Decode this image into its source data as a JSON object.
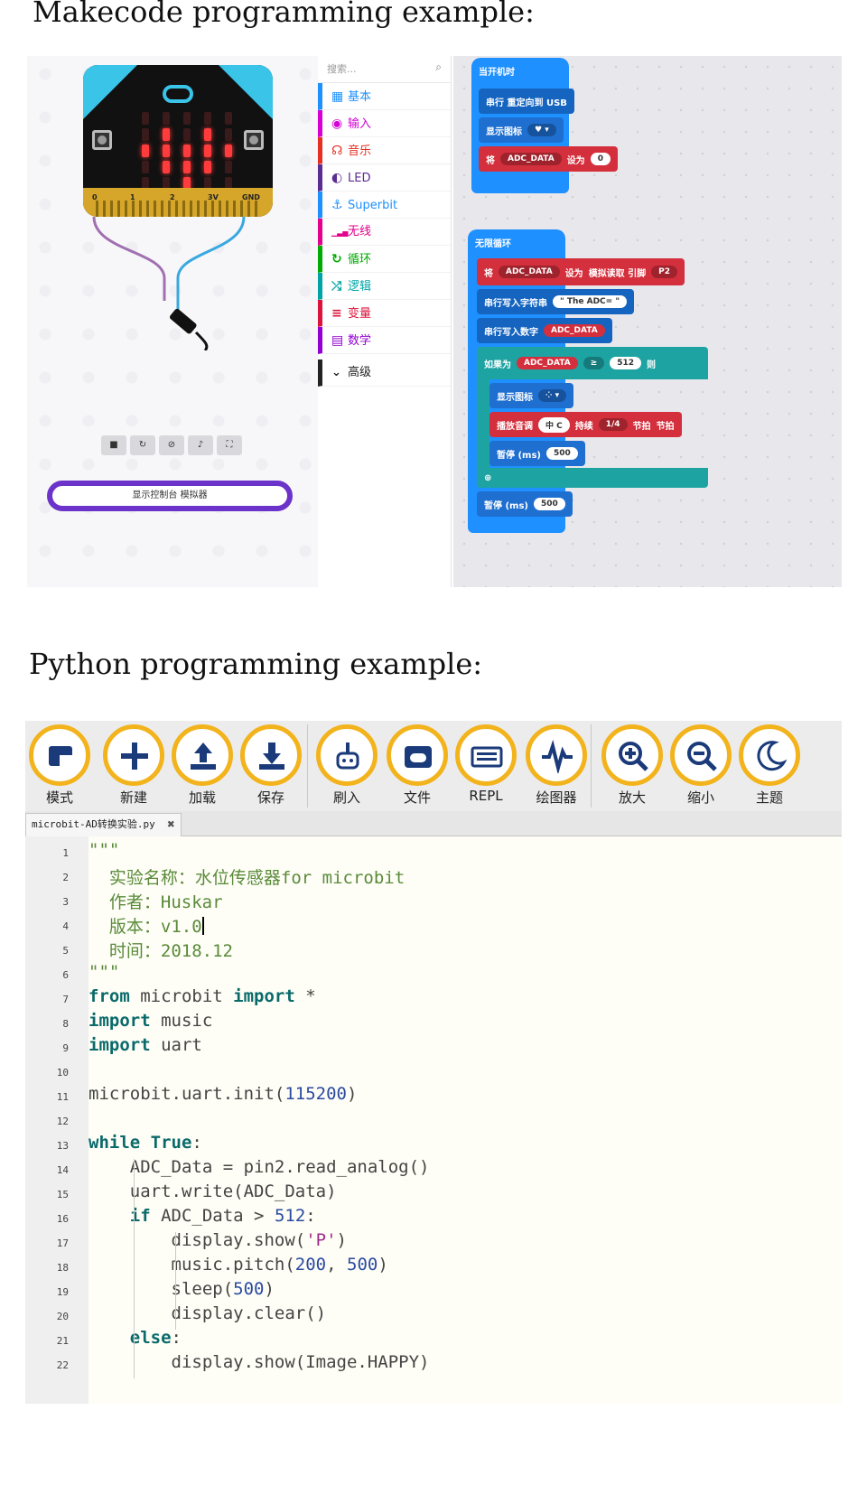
{
  "headings": {
    "makecode": "Makecode programming example:",
    "python": "Python programming example:"
  },
  "makecode": {
    "simulator": {
      "pins": [
        "0",
        "1",
        "2",
        "3V",
        "GND"
      ],
      "led_matrix": [
        0,
        0,
        0,
        0,
        0,
        0,
        1,
        0,
        1,
        0,
        1,
        1,
        1,
        1,
        1,
        0,
        1,
        1,
        1,
        0,
        0,
        0,
        1,
        0,
        0
      ],
      "console_button": "显示控制台 模拟器"
    },
    "toolbox": {
      "search_placeholder": "搜索...",
      "categories": [
        {
          "label": "基本",
          "icon": "grid-icon",
          "color": "#1e90ff"
        },
        {
          "label": "输入",
          "icon": "target-icon",
          "color": "#d400d4"
        },
        {
          "label": "音乐",
          "icon": "headphones-icon",
          "color": "#e63022"
        },
        {
          "label": "LED",
          "icon": "toggle-icon",
          "color": "#5c2d91"
        },
        {
          "label": "Superbit",
          "icon": "anchor-icon",
          "color": "#1e90ff"
        },
        {
          "label": "无线",
          "icon": "signal-icon",
          "color": "#e3008c"
        },
        {
          "label": "循环",
          "icon": "loop-icon",
          "color": "#00aa00"
        },
        {
          "label": "逻辑",
          "icon": "shuffle-icon",
          "color": "#00a4a6"
        },
        {
          "label": "变量",
          "icon": "list-icon",
          "color": "#dc143c"
        },
        {
          "label": "数学",
          "icon": "calculator-icon",
          "color": "#9400d3"
        }
      ],
      "advanced": "高级"
    },
    "blocks": {
      "on_start": "当开机时",
      "serial_redirect": "串行 重定向到 USB",
      "show_icon": "显示图标",
      "set": "将",
      "var": "ADC_DATA",
      "set_to": "设为",
      "zero": "0",
      "forever": "无限循环",
      "analog_read": "模拟读取 引脚",
      "pin": "P2",
      "serial_write_string": "串行写入字符串",
      "string_val": "\" The ADC= \"",
      "serial_write_number": "串行写入数字",
      "if": "如果为",
      "op": "≥",
      "threshold": "512",
      "then": "则",
      "play_tone": "播放音调",
      "tone": "中 C",
      "duration": "持续",
      "beat": "1/4",
      "beat_unit": "节拍",
      "beat_unit2": "节拍",
      "pause": "暂停 (ms)",
      "pause_val": "500"
    }
  },
  "mu": {
    "toolbar": [
      {
        "label": "模式",
        "icon": "mode-icon"
      },
      {
        "label": "新建",
        "icon": "plus-icon"
      },
      {
        "label": "加载",
        "icon": "upload-icon"
      },
      {
        "label": "保存",
        "icon": "download-icon"
      },
      {
        "label": "刷入",
        "icon": "flash-icon"
      },
      {
        "label": "文件",
        "icon": "files-icon"
      },
      {
        "label": "REPL",
        "icon": "keyboard-icon"
      },
      {
        "label": "绘图器",
        "icon": "plotter-icon"
      },
      {
        "label": "放大",
        "icon": "zoom-in-icon"
      },
      {
        "label": "缩小",
        "icon": "zoom-out-icon"
      },
      {
        "label": "主题",
        "icon": "moon-icon"
      }
    ],
    "tab": "microbit-AD转换实验.py",
    "lines": [
      "\"\"\"",
      "  实验名称：水位传感器for microbit",
      "  作者：Huskar",
      "  版本：v1.0",
      "  时间：2018.12",
      "\"\"\"",
      "from microbit import *",
      "import music",
      "import uart",
      "",
      "microbit.uart.init(115200)",
      "",
      "while True:",
      "    ADC_Data = pin2.read_analog()",
      "    uart.write(ADC_Data)",
      "    if ADC_Data > 512:",
      "        display.show('P')",
      "        music.pitch(200, 500)",
      "        sleep(500)",
      "        display.clear()",
      "    else:",
      "        display.show(Image.HAPPY)"
    ]
  }
}
